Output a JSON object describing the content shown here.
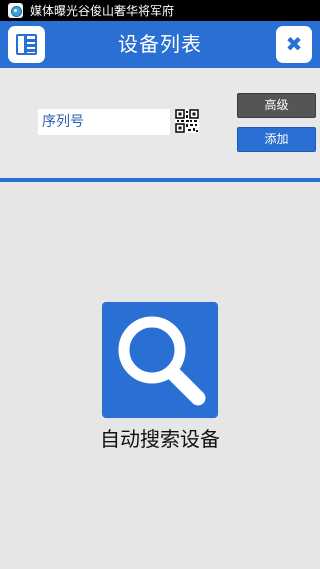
{
  "status_bar": {
    "notification_text": "媒体曝光谷俊山奢华将军府",
    "app_icon": "app-logo-icon"
  },
  "header": {
    "title": "设备列表",
    "left_icon": "menu-icon",
    "right_icon": "close-icon",
    "close_glyph": "✖"
  },
  "form": {
    "serial_placeholder": "序列号",
    "serial_value": "",
    "qr_icon": "qr-code-icon",
    "advanced_label": "高级",
    "add_label": "添加"
  },
  "main": {
    "auto_search_label": "自动搜索设备",
    "search_icon": "magnifier-icon"
  },
  "colors": {
    "primary": "#2a6fd3",
    "background": "#e6e6e6",
    "advanced_button": "#555555"
  }
}
